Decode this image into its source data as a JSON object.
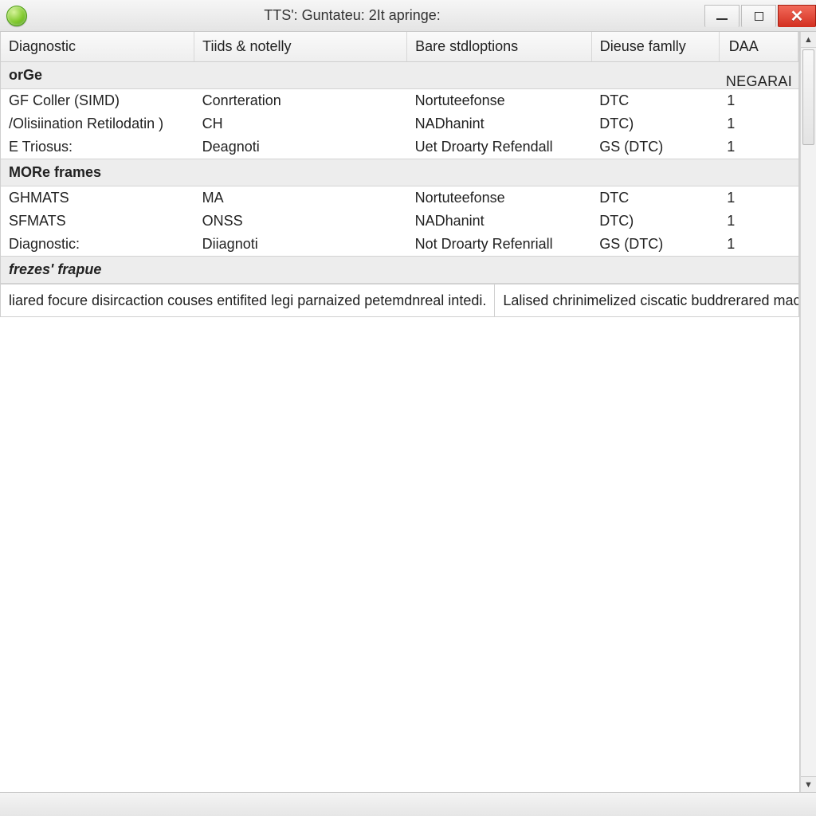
{
  "window": {
    "title": "TTS': Guntateu: 2It apringe:"
  },
  "columns": [
    "Diagnostic",
    "Tiids & notelly",
    "Bare stdloptions",
    "Dieuse famlly",
    "DAA"
  ],
  "right_label": "NEGARAI",
  "groups": [
    {
      "title": "orGe",
      "rows": [
        {
          "c0": "GF Coller (SIMD)",
          "c1": "Conrteration",
          "c2": "Nortuteefonse",
          "c3": "DTC",
          "c4": "1"
        },
        {
          "c0": "/Olisiination Retilodatin )",
          "c1": "CH",
          "c2": "NADhanint",
          "c3": "DTC)",
          "c4": "1"
        },
        {
          "c0": "E Triosus:",
          "c1": "Deagnoti",
          "c2": "Uet Droarty Refendall",
          "c3": "GS (DTC)",
          "c4": "1"
        }
      ]
    },
    {
      "title": "MORe frames",
      "rows": [
        {
          "c0": "GHMATS",
          "c1": "MA",
          "c2": "Nortuteefonse",
          "c3": "DTC",
          "c4": "1"
        },
        {
          "c0": "SFMATS",
          "c1": "ONSS",
          "c2": "NADhanint",
          "c3": "DTC)",
          "c4": "1"
        },
        {
          "c0": "Diagnostic:",
          "c1": "Diiagnoti",
          "c2": "Not Droarty Refenriall",
          "c3": "GS (DTC)",
          "c4": "1"
        }
      ]
    }
  ],
  "freeze": {
    "title": "frezes' frapue",
    "left": "liared focure disircaction couses entifited legi parnaized petemdnreal intedi.",
    "right": "Lalised chrinimelized ciscatic buddrerared macked flease dinder."
  }
}
